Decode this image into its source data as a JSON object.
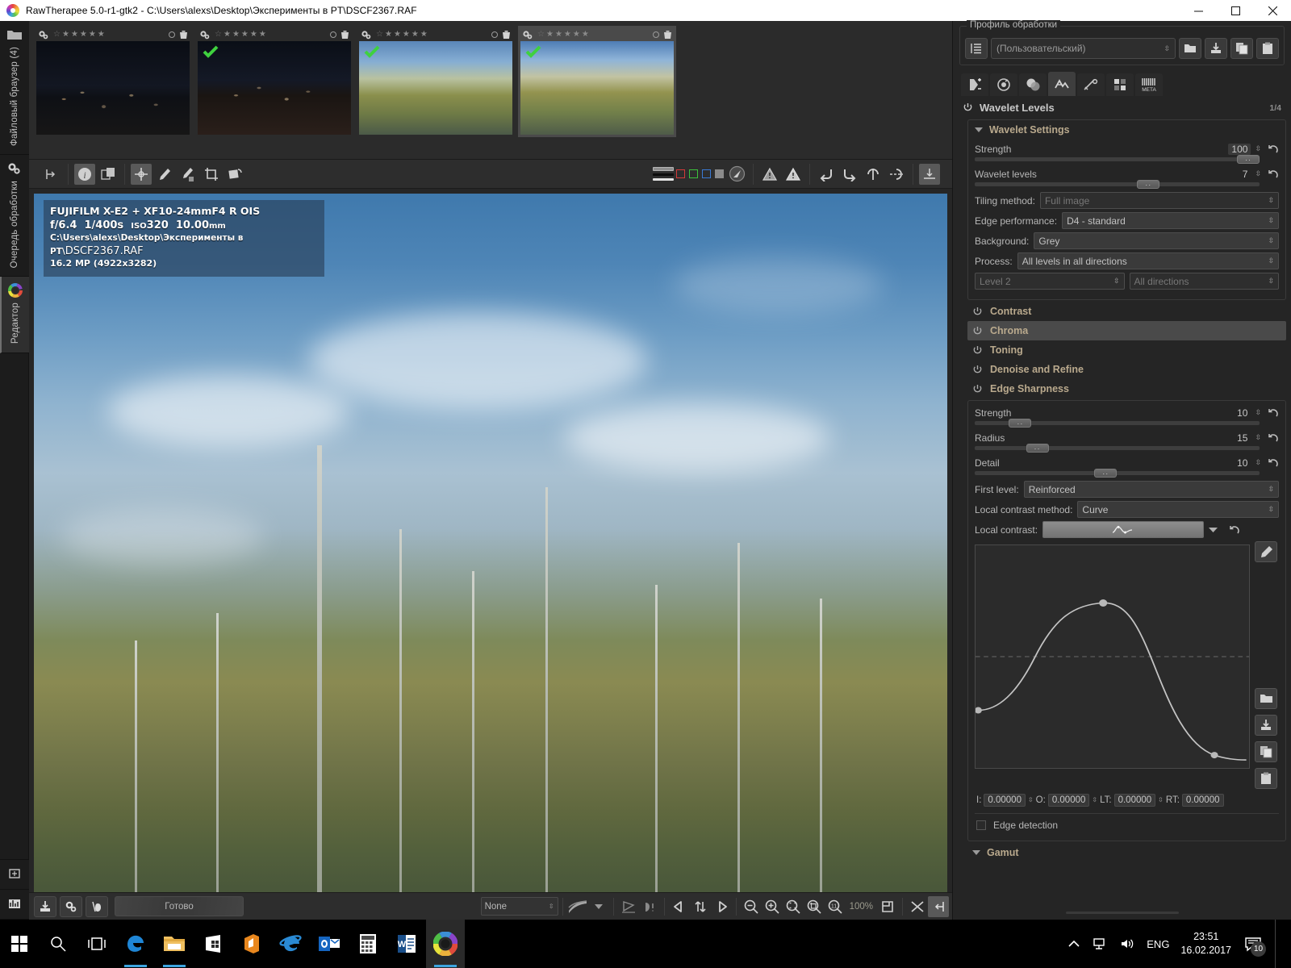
{
  "window": {
    "title": "RawTherapee 5.0-r1-gtk2 - C:\\Users\\alexs\\Desktop\\Эксперименты в PT\\DSCF2367.RAF",
    "logo_icon": "rawtherapee-logo-icon",
    "minimize_label": "─",
    "maximize_label": "❐",
    "close_label": "✕"
  },
  "rail": {
    "tabs": [
      {
        "label": "Файловый браузер (4)",
        "icon": "folder-icon",
        "active": false
      },
      {
        "label": "Очередь обработки",
        "icon": "gears-icon",
        "active": false
      },
      {
        "label": "Редактор",
        "icon": "color-wheel-icon",
        "active": true
      }
    ],
    "bottom_buttons": [
      {
        "icon": "arrange-icon"
      },
      {
        "icon": "histogram-icon"
      }
    ]
  },
  "filmstrip": {
    "thumbs": [
      {
        "rating": 0,
        "checked": false,
        "selected": false,
        "style": "night1",
        "trash_icon": "trash-icon",
        "gear_icon": "gear-icon"
      },
      {
        "rating": 0,
        "checked": true,
        "selected": false,
        "style": "night2",
        "trash_icon": "trash-icon",
        "gear_icon": "gear-icon"
      },
      {
        "rating": 0,
        "checked": true,
        "selected": false,
        "style": "autumn1",
        "trash_icon": "trash-icon",
        "gear_icon": "gear-icon"
      },
      {
        "rating": 0,
        "checked": true,
        "selected": true,
        "style": "autumn2",
        "trash_icon": "trash-icon",
        "gear_icon": "gear-icon"
      }
    ]
  },
  "editor_toolbar": {
    "left_tools": [
      {
        "name": "hide-left-panel-icon",
        "active": false
      },
      {
        "name": "info-icon",
        "active": true
      },
      {
        "name": "before-after-icon",
        "active": false
      },
      {
        "name": "crosshair-pointer-icon",
        "active": true
      },
      {
        "name": "white-balance-picker-icon",
        "active": false
      },
      {
        "name": "spot-wb-picker-icon",
        "active": false
      },
      {
        "name": "crop-icon",
        "active": false
      },
      {
        "name": "straighten-icon",
        "active": false
      }
    ],
    "indicator_swatches": [
      {
        "name": "red-swatch",
        "color": "#d43a3a"
      },
      {
        "name": "green-swatch",
        "color": "#3cc23c"
      },
      {
        "name": "blue-swatch",
        "color": "#3a7ad4"
      },
      {
        "name": "grey-swatch",
        "color": "#8a8a8a"
      }
    ],
    "right_tools": [
      {
        "name": "navigator-icon"
      },
      {
        "name": "clipping-shadows-warning-icon"
      },
      {
        "name": "clipping-highlights-warning-icon"
      },
      {
        "name": "rotate-left-icon"
      },
      {
        "name": "rotate-right-icon"
      },
      {
        "name": "flip-vertical-icon"
      },
      {
        "name": "flip-horizontal-icon"
      },
      {
        "name": "hide-right-panel-icon"
      }
    ]
  },
  "image_info": {
    "camera_lens": "FUJIFILM X-E2 + XF10-24mmF4 R OIS",
    "aperture": "f/6.4",
    "shutter": "1/400s",
    "iso_prefix": "ISO",
    "iso": "320",
    "focal": "10.00",
    "focal_unit": "mm",
    "path": "C:\\Users\\alexs\\Desktop\\Эксперименты в PT\\",
    "filename": "DSCF2367.RAF",
    "resolution": "16.2 MP (4922x3282)"
  },
  "bottom_bar": {
    "left_buttons": [
      {
        "name": "save-image-icon"
      },
      {
        "name": "queue-icon"
      },
      {
        "name": "send-to-editor-icon"
      }
    ],
    "status": "Готово",
    "mode_select": {
      "value": "None",
      "options": [
        "None"
      ]
    },
    "gradient_icon": "gradient-icon",
    "extra_tools": [
      {
        "name": "perspective-icon"
      },
      {
        "name": "shadow-highlight-icon"
      }
    ],
    "nav": [
      {
        "name": "previous-image-icon"
      },
      {
        "name": "sync-icon"
      },
      {
        "name": "next-image-icon"
      }
    ],
    "zoom_tools": [
      {
        "name": "zoom-out-icon"
      },
      {
        "name": "zoom-in-icon"
      },
      {
        "name": "zoom-fit-icon"
      },
      {
        "name": "zoom-crop-icon"
      },
      {
        "name": "zoom-100-icon"
      }
    ],
    "zoom_level": "100%",
    "fullscreen_icon": "fullscreen-icon",
    "before_after_icon": "before-after-toggle-icon",
    "hide-panel-icon": "hide-right-panel-icon"
  },
  "right_panel": {
    "profile": {
      "legend": "Профиль обработки",
      "selected": "(Пользовательский)",
      "list_icon": "profile-list-icon",
      "buttons": [
        {
          "name": "load-profile-icon"
        },
        {
          "name": "save-profile-icon"
        },
        {
          "name": "copy-profile-icon"
        },
        {
          "name": "paste-profile-icon"
        }
      ]
    },
    "tabs": [
      {
        "name": "exposure-tab-icon",
        "active": false
      },
      {
        "name": "detail-tab-icon",
        "active": false
      },
      {
        "name": "color-tab-icon",
        "active": false
      },
      {
        "name": "advanced-tab-icon",
        "active": true
      },
      {
        "name": "transform-tab-icon",
        "active": false
      },
      {
        "name": "raw-tab-icon",
        "active": false
      },
      {
        "name": "metadata-tab-icon",
        "active": false,
        "text": "META"
      }
    ],
    "section": {
      "title": "Wavelet Levels",
      "power_icon": "power-icon",
      "page_indicator": "1/4"
    },
    "wavelet_settings": {
      "title": "Wavelet Settings",
      "strength": {
        "label": "Strength",
        "value": "100",
        "fill": 100
      },
      "levels": {
        "label": "Wavelet levels",
        "value": "7",
        "fill": 57
      },
      "tiling_method": {
        "label": "Tiling method:",
        "value": "Full image",
        "disabled": true
      },
      "edge_performance": {
        "label": "Edge performance:",
        "value": "D4 - standard"
      },
      "background": {
        "label": "Background:",
        "value": "Grey"
      },
      "process": {
        "label": "Process:",
        "value": "All levels in all directions"
      },
      "level_select": {
        "value": "Level 2",
        "disabled": true
      },
      "direction_select": {
        "value": "All directions",
        "disabled": true
      }
    },
    "toggles": [
      {
        "label": "Contrast",
        "highlight": false,
        "power_icon": "power-icon"
      },
      {
        "label": "Chroma",
        "highlight": true,
        "power_icon": "power-icon"
      },
      {
        "label": "Toning",
        "highlight": false,
        "power_icon": "power-icon"
      },
      {
        "label": "Denoise and Refine",
        "highlight": false,
        "power_icon": "power-icon"
      },
      {
        "label": "Edge Sharpness",
        "highlight": false,
        "power_icon": "power-icon"
      }
    ],
    "edge_sharpness": {
      "strength": {
        "label": "Strength",
        "value": "10",
        "fill": 12
      },
      "radius": {
        "label": "Radius",
        "value": "15",
        "fill": 18
      },
      "detail": {
        "label": "Detail",
        "value": "10",
        "fill": 40
      },
      "first_level": {
        "label": "First level:",
        "value": "Reinforced"
      },
      "local_contrast_method": {
        "label": "Local contrast method:",
        "value": "Curve"
      },
      "local_contrast": {
        "label": "Local contrast:",
        "curve_icon": "curve-preview-icon"
      },
      "curve_type_icon": "curve-type-icon",
      "reset_icon": "reset-icon",
      "side_buttons": [
        {
          "name": "edit-curve-icon"
        },
        {
          "name": "load-curve-icon"
        },
        {
          "name": "save-curve-icon"
        },
        {
          "name": "copy-curve-icon"
        },
        {
          "name": "paste-curve-icon"
        }
      ],
      "coords": [
        {
          "label": "I:",
          "value": "0.00000"
        },
        {
          "label": "O:",
          "value": "0.00000"
        },
        {
          "label": "LT:",
          "value": "0.00000"
        },
        {
          "label": "RT:",
          "value": "0.00000"
        }
      ],
      "edge_detection": {
        "label": "Edge detection",
        "checked": false
      }
    },
    "gamut": {
      "label": "Gamut"
    }
  },
  "curve_data": {
    "type": "line",
    "title": "Local contrast curve",
    "points": [
      {
        "x": 0.0,
        "y": 0.26
      },
      {
        "x": 0.49,
        "y": 0.72
      },
      {
        "x": 1.0,
        "y": 0.04
      }
    ],
    "midline_y": 0.5,
    "xlim": [
      0,
      1
    ],
    "ylim": [
      0,
      1
    ],
    "grid": false
  },
  "taskbar": {
    "items": [
      {
        "name": "start-button-icon"
      },
      {
        "name": "search-icon"
      },
      {
        "name": "task-view-icon"
      },
      {
        "name": "edge-browser-icon",
        "running": true
      },
      {
        "name": "file-explorer-icon",
        "running": true
      },
      {
        "name": "microsoft-store-icon",
        "running": false
      },
      {
        "name": "office-icon",
        "running": false
      },
      {
        "name": "internet-explorer-icon",
        "running": false
      },
      {
        "name": "outlook-icon",
        "running": false
      },
      {
        "name": "calculator-icon",
        "running": false
      },
      {
        "name": "word-icon",
        "running": false
      },
      {
        "name": "rawtherapee-taskbar-icon",
        "running": true,
        "active": true
      }
    ],
    "tray": {
      "chevron_icon": "show-hidden-icons-icon",
      "network_icon": "network-icon",
      "volume_icon": "volume-icon",
      "language": "ENG",
      "time": "23:51",
      "date": "16.02.2017",
      "notifications_icon": "action-center-icon",
      "notifications_count": "10"
    }
  }
}
